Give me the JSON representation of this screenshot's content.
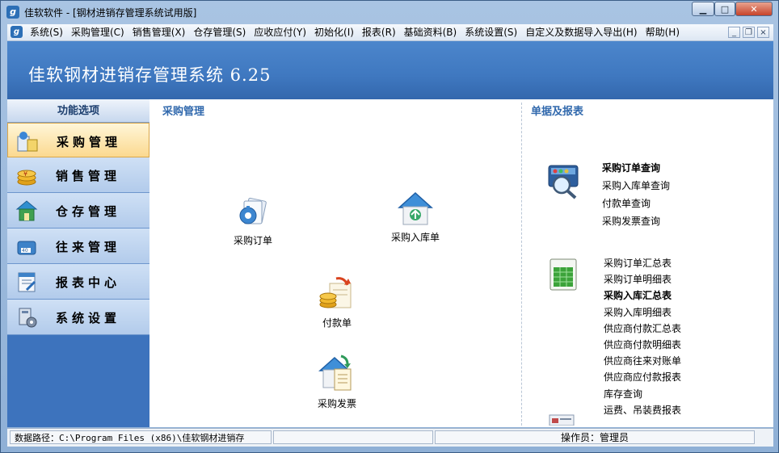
{
  "window": {
    "title": "佳软软件 - [钢材进销存管理系统试用版]",
    "app_icon": "app-logo-icon",
    "buttons": {
      "minimize": "▁",
      "maximize": "□",
      "close": "✕"
    }
  },
  "menubar": {
    "items": [
      "系统(S)",
      "采购管理(C)",
      "销售管理(X)",
      "仓存管理(S)",
      "应收应付(Y)",
      "初始化(I)",
      "报表(R)",
      "基础资料(B)",
      "系统设置(S)",
      "自定义及数据导入导出(H)",
      "帮助(H)"
    ],
    "mdi_buttons": {
      "minimize": "_",
      "restore": "❐",
      "close": "×"
    }
  },
  "banner": {
    "title": "佳软钢材进销存管理系统 6.25"
  },
  "sidebar": {
    "header": "功能选项",
    "items": [
      {
        "label": "采购管理",
        "icon": "purchase-icon",
        "active": true
      },
      {
        "label": "销售管理",
        "icon": "sales-icon",
        "active": false
      },
      {
        "label": "仓存管理",
        "icon": "warehouse-icon",
        "active": false
      },
      {
        "label": "往来管理",
        "icon": "accounts-icon",
        "active": false
      },
      {
        "label": "报表中心",
        "icon": "report-icon",
        "active": false
      },
      {
        "label": "系统设置",
        "icon": "settings-icon",
        "active": false
      }
    ]
  },
  "main": {
    "section_title": "采购管理",
    "tiles": [
      {
        "label": "采购订单",
        "icon": "purchase-order-icon"
      },
      {
        "label": "采购入库单",
        "icon": "purchase-receipt-icon"
      },
      {
        "label": "付款单",
        "icon": "payment-icon"
      },
      {
        "label": "采购发票",
        "icon": "purchase-invoice-icon"
      }
    ]
  },
  "reports": {
    "section_title": "单据及报表",
    "query_group": {
      "icon": "query-magnifier-icon",
      "links": [
        {
          "label": "采购订单查询",
          "bold": true
        },
        {
          "label": "采购入库单查询",
          "bold": false
        },
        {
          "label": "付款单查询",
          "bold": false
        },
        {
          "label": "采购发票查询",
          "bold": false
        }
      ]
    },
    "report_group": {
      "icon": "report-chart-icon",
      "links": [
        {
          "label": "采购订单汇总表",
          "bold": false
        },
        {
          "label": "采购订单明细表",
          "bold": false
        },
        {
          "label": "采购入库汇总表",
          "bold": true
        },
        {
          "label": "采购入库明细表",
          "bold": false
        },
        {
          "label": "供应商付款汇总表",
          "bold": false
        },
        {
          "label": "供应商付款明细表",
          "bold": false
        },
        {
          "label": "供应商往来对账单",
          "bold": false
        },
        {
          "label": "供应商应付款报表",
          "bold": false
        },
        {
          "label": "库存查询",
          "bold": false
        },
        {
          "label": "运费、吊装费报表",
          "bold": false
        }
      ]
    }
  },
  "statusbar": {
    "data_path": "数据路径：C:\\Program Files (x86)\\佳软钢材进销存",
    "middle": "",
    "operator": "操作员：管理员"
  }
}
